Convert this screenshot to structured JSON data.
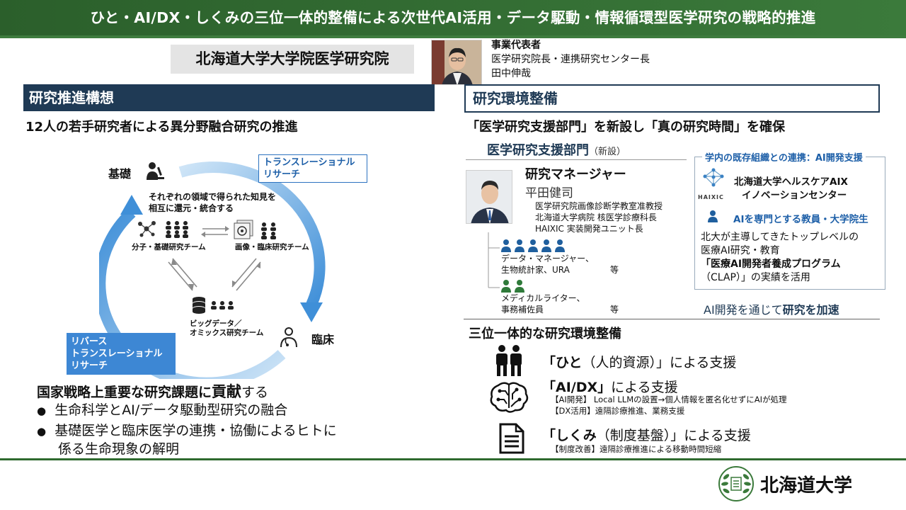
{
  "banner": {
    "title": "ひと・AI/DX・しくみの三位一体的整備による次世代AI活用・データ駆動・情報循環型医学研究の戦略的推進"
  },
  "institution": {
    "name": "北海道大学大学院医学研究院"
  },
  "representative": {
    "role": "事業代表者",
    "title": "医学研究院長・連携研究センター長",
    "name": "田中伸哉"
  },
  "left": {
    "section_title": "研究推進構想",
    "subtitle": "12人の若手研究者による異分野融合研究の推進",
    "cycle": {
      "basic_label": "基礎",
      "clinical_label": "臨床",
      "translational": [
        "トランスレーショナル",
        "リサーチ"
      ],
      "reverse": [
        "リバース",
        "トランスレーショナル",
        "リサーチ"
      ],
      "note": [
        "それぞれの領域で得られた知見を",
        "相互に還元・統合する"
      ],
      "team_molecular": "分子・基礎研究チーム",
      "team_imaging": "画像・臨床研究チーム",
      "team_bigdata": [
        "ビッグデータ／",
        "オミックス研究チーム"
      ]
    },
    "contribution": {
      "text_a": "国家戦略上重要な研究課題に",
      "text_b": "貢献",
      "text_c": "する"
    },
    "bullets": [
      "生命科学とAI/データ駆動型研究の融合",
      "基礎医学と臨床医学の連携・協働によるヒトに",
      "係る生命現象の解明"
    ]
  },
  "right": {
    "section_title": "研究環境整備",
    "subtitle": "「医学研究支援部門」を新設し「真の研究時間」を確保",
    "dept": {
      "name": "医学研究支援部門",
      "tag": "（新設）"
    },
    "manager": {
      "role": "研究マネージャー",
      "name": "平田健司",
      "affiliations": [
        "医学研究院画像診断学教室准教授",
        "北海道大学病院 核医学診療科長",
        "HAIXIC 実装開発ユニット長"
      ]
    },
    "staff": [
      {
        "line1": "データ・マネージャー、",
        "line2": "生物統計家、URA",
        "etc": "等"
      },
      {
        "line1": "メディカルライター、",
        "line2": "事務補佐員",
        "etc": "等"
      }
    ],
    "coop": {
      "title": "学内の既存組織との連携：AI開発支援",
      "logo_text": "HAIXIC",
      "center": [
        "北海道大学ヘルスケアAIX",
        "イノベーションセンター"
      ],
      "faculty": "AIを専門とする教員・大学院生",
      "desc": [
        "北大が主導してきたトップレベルの",
        "医療AI研究・教育",
        "「医療AI開発者養成プログラム",
        "（CLAP）」の実績を活用"
      ]
    },
    "accelerate": {
      "text_a": "AI開発を通じて",
      "text_b": "研究を加速"
    },
    "trinity_title": "三位一体的な研究環境整備",
    "pillars": [
      {
        "bracket": "「ひと",
        "rest": "（人的資源）」による支援",
        "details": []
      },
      {
        "bracket": "「AI/DX」",
        "rest": "による支援",
        "details": [
          "【AI開発】 Local LLMの設置→個人情報を匿名化せずにAIが処理",
          "【DX活用】遠隔診療推進、業務支援"
        ]
      },
      {
        "bracket": "「しくみ",
        "rest": "（制度基盤）」による支援",
        "details": [
          "【制度改善】遠隔診療推進による移動時間短縮"
        ]
      }
    ]
  },
  "footer": {
    "university": "北海道大学"
  },
  "colors": {
    "banner": "#2f6a2f",
    "navy": "#1f3a55",
    "accent_blue": "#2d73c0",
    "staff_blue": "#1f5f9e",
    "staff_green": "#2f7a3a"
  }
}
